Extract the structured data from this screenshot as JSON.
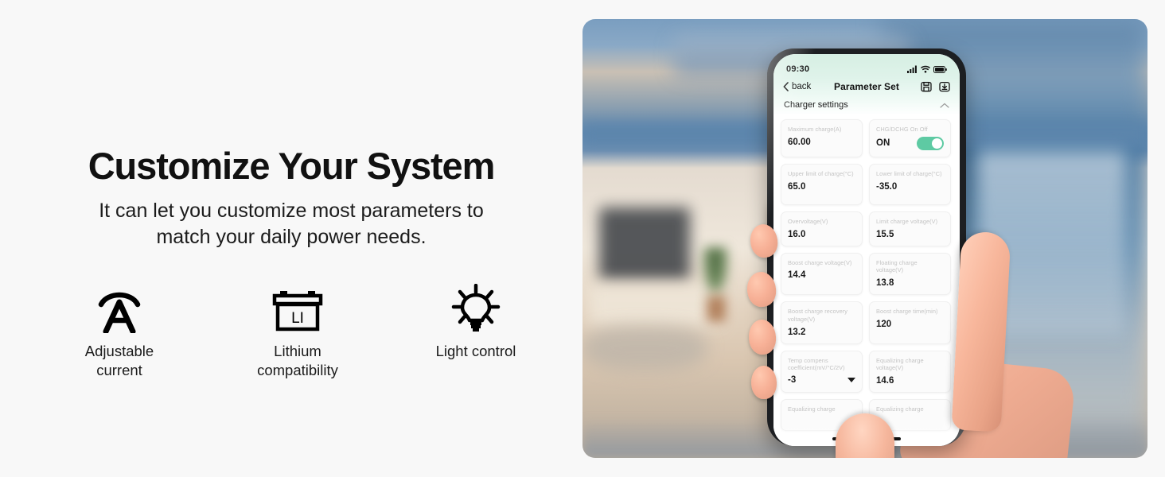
{
  "promo": {
    "headline": "Customize Your System",
    "subhead_line1": "It can let you customize most parameters to",
    "subhead_line2": "match your daily power needs.",
    "features": [
      {
        "icon": "adjustable-current-icon",
        "label_line1": "Adjustable",
        "label_line2": "current"
      },
      {
        "icon": "lithium-battery-icon",
        "battery_text": "LI",
        "label_line1": "Lithium",
        "label_line2": "compatibility"
      },
      {
        "icon": "light-bulb-icon",
        "label_line1": "Light control",
        "label_line2": ""
      }
    ]
  },
  "phone": {
    "statusbar": {
      "time": "09:30",
      "signal_icon": "cellular-signal-icon",
      "wifi_icon": "wifi-icon",
      "battery_icon": "battery-icon"
    },
    "navbar": {
      "back_label": "back",
      "back_icon": "chevron-left-icon",
      "title": "Parameter Set",
      "save_icon": "save-icon",
      "download_icon": "download-icon"
    },
    "section": {
      "title": "Charger settings",
      "collapse_icon": "chevron-up-icon"
    },
    "cards": [
      {
        "label": "Maximum charge(A)",
        "value": "60.00",
        "type": "value",
        "size": "h1"
      },
      {
        "label": "CHG/DCHG On Off",
        "value": "ON",
        "type": "toggle",
        "toggle_on": true,
        "size": "h1"
      },
      {
        "label": "Upper limit of charge(°C)",
        "value": "65.0",
        "type": "value",
        "size": "h2"
      },
      {
        "label": "Lower limit of charge(°C)",
        "value": "-35.0",
        "type": "value",
        "size": "h2"
      },
      {
        "label": "Overvoltage(V)",
        "value": "16.0",
        "type": "value",
        "size": "h1"
      },
      {
        "label": "Limit charge voltage(V)",
        "value": "15.5",
        "type": "value",
        "size": "h1"
      },
      {
        "label": "Boost charge voltage(V)",
        "value": "14.4",
        "type": "value",
        "size": "h1"
      },
      {
        "label": "Floating charge voltage(V)",
        "value": "13.8",
        "type": "value",
        "size": "h2"
      },
      {
        "label": "Boost charge recovery voltage(V)",
        "value": "13.2",
        "type": "value",
        "size": "h2"
      },
      {
        "label": "Boost charge time(min)",
        "value": "120",
        "type": "value",
        "size": "h2"
      },
      {
        "label": "Temp compens coefficient(mV/°C/2V)",
        "value": "-3",
        "type": "dropdown",
        "size": "h2"
      },
      {
        "label": "Equalizing charge voltage(V)",
        "value": "14.6",
        "type": "value",
        "size": "h2"
      },
      {
        "label": "Equalizing charge",
        "value": "",
        "type": "value",
        "size": "h1"
      },
      {
        "label": "Equalizing charge",
        "value": "",
        "type": "value",
        "size": "h1"
      }
    ],
    "home_indicator": "home-indicator"
  },
  "colors": {
    "page_background": "#f8f8f8",
    "toggle_on": "#5ecaa3",
    "header_mint": "#d6efe3",
    "text_primary": "#111111",
    "label_gray": "#c4c4c4"
  }
}
